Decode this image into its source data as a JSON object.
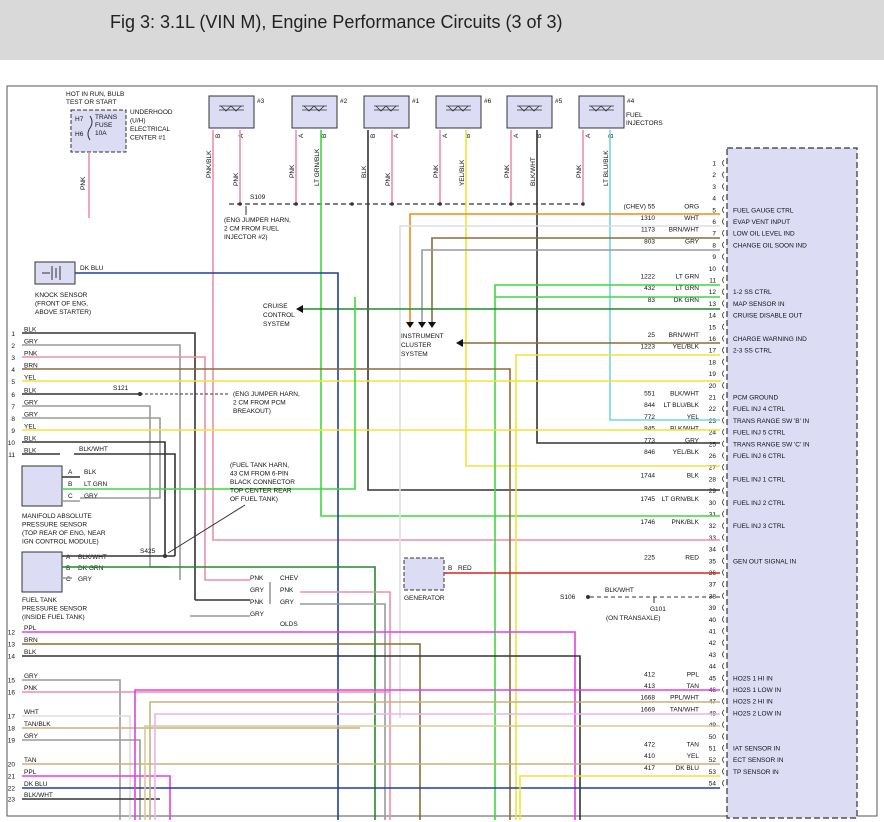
{
  "header": {
    "title": "Fig 3: 3.1L (VIN M), Engine Performance Circuits (3 of 3)"
  },
  "fuse": {
    "caption": [
      "HOT IN RUN, BULB",
      "TEST OR START"
    ],
    "h7": "H7",
    "h6": "H6",
    "name": [
      "TRANS",
      "FUSE",
      "10A"
    ],
    "center": [
      "UNDERHOOD",
      "(U/H)",
      "ELECTRICAL",
      "CENTER #1"
    ]
  },
  "injectors": [
    {
      "num": "#3",
      "pinB": "B",
      "pinA": "A",
      "wireB": "PNK/BLK",
      "wireA": "PNK"
    },
    {
      "num": "#2",
      "pinB": "A",
      "pinA": "B",
      "wireB": "PNK",
      "wireA": "LT GRN/BLK"
    },
    {
      "num": "#1",
      "pinB": "B",
      "pinA": "A",
      "wireB": "BLK",
      "wireA": "PNK"
    },
    {
      "num": "#6",
      "pinB": "A",
      "pinA": "B",
      "wireB": "PNK",
      "wireA": "YEL/BLK"
    },
    {
      "num": "#5",
      "pinB": "A",
      "pinA": "B",
      "wireB": "PNK",
      "wireA": "BLK/WHT"
    },
    {
      "num": "#4",
      "pinB": "A",
      "pinA": "B",
      "wireB": "PNK",
      "wireA": "LT BLU/BLK"
    }
  ],
  "injectors_label": [
    "FUEL",
    "INJECTORS"
  ],
  "splices": {
    "s109": "S109",
    "s109_note": [
      "(ENG JUMPER HARN,",
      "2 CM FROM FUEL",
      "INJECTOR #2)"
    ],
    "s121": "S121",
    "s121_note": [
      "(ENG JUMPER HARN,",
      "2 CM FROM PCM",
      "BREAKOUT)"
    ],
    "s425": "S425",
    "s425_note": [
      "(FUEL TANK HARN,",
      "43 CM FROM 6-PIN",
      "BLACK CONNECTOR",
      "TOP CENTER REAR",
      "OF FUEL TANK)"
    ],
    "s106": "S106",
    "g101": "G101",
    "g101_note": "(ON TRANSAXLE)"
  },
  "fuse_wire": "PNK",
  "knock": {
    "wire": "DK BLU",
    "label": [
      "KNOCK SENSOR",
      "(FRONT OF ENG,",
      "ABOVE STARTER)"
    ]
  },
  "cruise": [
    "CRUISE",
    "CONTROL",
    "SYSTEM"
  ],
  "cluster": [
    "INSTRUMENT",
    "CLUSTER",
    "SYSTEM"
  ],
  "generator": {
    "pin": "B",
    "wire": "RED",
    "label": "GENERATOR"
  },
  "s106_wire": "BLK/WHT",
  "left_connector": [
    {
      "pin": "1",
      "color": "BLK"
    },
    {
      "pin": "2",
      "color": "GRY"
    },
    {
      "pin": "3",
      "color": "PNK"
    },
    {
      "pin": "4",
      "color": "BRN"
    },
    {
      "pin": "5",
      "color": "YEL"
    },
    {
      "pin": "6",
      "color": "BLK"
    },
    {
      "pin": "7",
      "color": "GRY"
    },
    {
      "pin": "8",
      "color": "GRY"
    },
    {
      "pin": "9",
      "color": "YEL"
    },
    {
      "pin": "10",
      "color": "BLK"
    },
    {
      "pin": "11",
      "color": "BLK"
    }
  ],
  "wire_11": "BLK/WHT",
  "map": {
    "pins": [
      [
        "A",
        "BLK"
      ],
      [
        "B",
        "LT GRN"
      ],
      [
        "C",
        "GRY"
      ]
    ],
    "label": [
      "MANIFOLD ABSOLUTE",
      "PRESSURE SENSOR",
      "(TOP REAR OF ENG, NEAR",
      "IGN CONTROL MODULE)"
    ]
  },
  "fuel_tank": {
    "pins": [
      [
        "A",
        "BLK/WHT"
      ],
      [
        "B",
        "DK GRN"
      ],
      [
        "C",
        "GRY"
      ]
    ],
    "label": [
      "FUEL TANK",
      "PRESSURE SENSOR",
      "(INSIDE FUEL TANK)"
    ]
  },
  "chev_olds": {
    "rows": [
      [
        "PNK",
        "CHEV"
      ],
      [
        "GRY",
        "PNK"
      ],
      [
        "PNK",
        "GRY"
      ],
      [
        "GRY",
        ""
      ]
    ],
    "olds": "OLDS"
  },
  "left_lower": [
    {
      "pin": "12",
      "color": "PPL"
    },
    {
      "pin": "13",
      "color": "BRN"
    },
    {
      "pin": "14",
      "color": "BLK"
    },
    {
      "pin": "15",
      "color": "GRY"
    },
    {
      "pin": "16",
      "color": "PNK"
    },
    {
      "pin": "17",
      "color": "WHT"
    },
    {
      "pin": "18",
      "color": "TAN/BLK"
    },
    {
      "pin": "19",
      "color": "GRY"
    },
    {
      "pin": "20",
      "color": "TAN"
    },
    {
      "pin": "21",
      "color": "PPL"
    },
    {
      "pin": "22",
      "color": "DK BLU"
    },
    {
      "pin": "23",
      "color": "BLK/WHT"
    }
  ],
  "pcm_pins": [
    "1",
    "2",
    "3",
    "4",
    "5",
    "6",
    "7",
    "8",
    "9",
    "10",
    "11",
    "12",
    "13",
    "14",
    "15",
    "16",
    "17",
    "18",
    "19",
    "20",
    "21",
    "22",
    "23",
    "24",
    "25",
    "26",
    "27",
    "28",
    "29",
    "30",
    "31",
    "32",
    "33",
    "34",
    "35",
    "36",
    "37",
    "38",
    "39",
    "40",
    "41",
    "42",
    "43",
    "44",
    "45",
    "46",
    "47",
    "48",
    "49",
    "50",
    "51",
    "52",
    "53",
    "54"
  ],
  "pcm_wires": [
    {
      "pin": "5",
      "circuit": "(CHEV)  55",
      "color": "ORG",
      "func": "FUEL GAUGE CTRL"
    },
    {
      "pin": "6",
      "circuit": "1310",
      "color": "WHT",
      "func": "EVAP VENT INPUT"
    },
    {
      "pin": "7",
      "circuit": "1173",
      "color": "BRN/WHT",
      "func": "LOW OIL LEVEL IND"
    },
    {
      "pin": "8",
      "circuit": "803",
      "color": "GRY",
      "func": "CHANGE OIL SOON IND"
    },
    {
      "pin": "11",
      "circuit": "1222",
      "color": "LT GRN",
      "func": ""
    },
    {
      "pin": "12",
      "circuit": "432",
      "color": "LT GRN",
      "func": "1-2 SS CTRL"
    },
    {
      "pin": "13",
      "circuit": "83",
      "color": "DK GRN",
      "func": "MAP SENSOR IN"
    },
    {
      "pin": "14",
      "circuit": "",
      "color": "",
      "func": "CRUISE DISABLE OUT"
    },
    {
      "pin": "16",
      "circuit": "25",
      "color": "BRN/WHT",
      "func": "CHARGE WARNING IND"
    },
    {
      "pin": "17",
      "circuit": "1223",
      "color": "YEL/BLK",
      "func": "2-3 SS CTRL"
    },
    {
      "pin": "21",
      "circuit": "551",
      "color": "BLK/WHT",
      "func": "PCM GROUND"
    },
    {
      "pin": "22",
      "circuit": "844",
      "color": "LT BLU/BLK",
      "func": "FUEL INJ 4 CTRL"
    },
    {
      "pin": "23",
      "circuit": "772",
      "color": "YEL",
      "func": "TRANS RANGE SW 'B' IN"
    },
    {
      "pin": "24",
      "circuit": "845",
      "color": "BLK/WHT",
      "func": "FUEL INJ 5 CTRL"
    },
    {
      "pin": "25",
      "circuit": "773",
      "color": "GRY",
      "func": "TRANS RANGE SW 'C' IN"
    },
    {
      "pin": "26",
      "circuit": "846",
      "color": "YEL/BLK",
      "func": "FUEL INJ 6 CTRL"
    },
    {
      "pin": "28",
      "circuit": "1744",
      "color": "BLK",
      "func": "FUEL INJ 1 CTRL"
    },
    {
      "pin": "30",
      "circuit": "1745",
      "color": "LT GRN/BLK",
      "func": "FUEL INJ 2 CTRL"
    },
    {
      "pin": "32",
      "circuit": "1746",
      "color": "PNK/BLK",
      "func": "FUEL INJ 3 CTRL"
    },
    {
      "pin": "35",
      "circuit": "225",
      "color": "RED",
      "func": "GEN OUT SIGNAL IN"
    },
    {
      "pin": "45",
      "circuit": "412",
      "color": "PPL",
      "func": "HO2S 1 HI IN"
    },
    {
      "pin": "46",
      "circuit": "413",
      "color": "TAN",
      "func": "HO2S 1 LOW IN"
    },
    {
      "pin": "47",
      "circuit": "1668",
      "color": "PPL/WHT",
      "func": "HO2S 2 HI IN"
    },
    {
      "pin": "48",
      "circuit": "1669",
      "color": "TAN/WHT",
      "func": "HO2S 2 LOW IN"
    },
    {
      "pin": "51",
      "circuit": "472",
      "color": "TAN",
      "func": "IAT SENSOR IN"
    },
    {
      "pin": "52",
      "circuit": "410",
      "color": "YEL",
      "func": "ECT SENSOR IN"
    },
    {
      "pin": "53",
      "circuit": "417",
      "color": "DK BLU",
      "func": "TP SENSOR IN"
    }
  ],
  "colors": {
    "pink": "#ee8fa8",
    "gray": "#9a9a9a",
    "black": "#333333",
    "brown": "#8b6b3d",
    "yellow": "#f0e23a",
    "ltgreen": "#3fd93f",
    "dkgreen": "#1e8a2e",
    "orange": "#f28c1a",
    "ltblue": "#6fd9e0",
    "dkblue": "#1d3fa0",
    "purple": "#e040e8",
    "tan": "#c8b07a",
    "red": "#e02020",
    "module": "#dcdcf5"
  }
}
